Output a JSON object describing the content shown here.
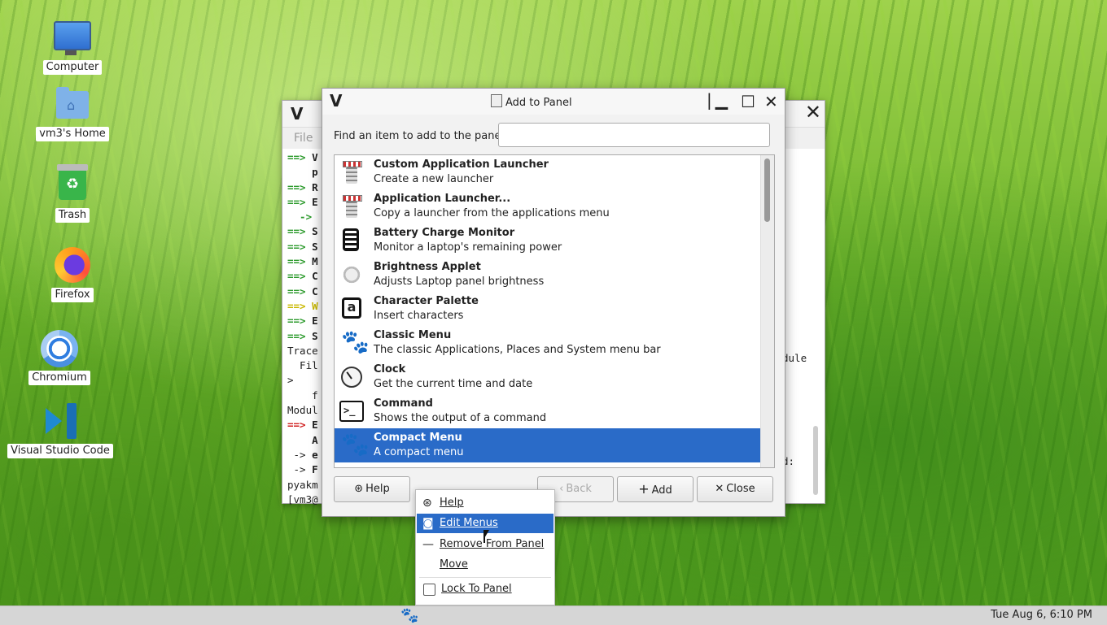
{
  "desktop": {
    "icons": [
      {
        "label": "Computer",
        "icon": "computer-icon"
      },
      {
        "label": "vm3's Home",
        "icon": "home-folder-icon"
      },
      {
        "label": "Trash",
        "icon": "trash-icon"
      },
      {
        "label": "Firefox",
        "icon": "firefox-icon"
      },
      {
        "label": "Chromium",
        "icon": "chromium-icon"
      },
      {
        "label": "Visual Studio Code",
        "icon": "vscode-icon"
      }
    ]
  },
  "terminal": {
    "menu_file": "File",
    "lines": [
      {
        "pre": "==> ",
        "rest": "V",
        "cls": "g"
      },
      {
        "pre": "    ",
        "rest": "p",
        "cls": ""
      },
      {
        "pre": "==> ",
        "rest": "R",
        "cls": "g"
      },
      {
        "pre": "==> ",
        "rest": "E",
        "cls": "g"
      },
      {
        "pre": "  -> ",
        "rest": "",
        "cls": "g"
      },
      {
        "pre": "==> ",
        "rest": "S",
        "cls": "g"
      },
      {
        "pre": "==> ",
        "rest": "S",
        "cls": "g"
      },
      {
        "pre": "==> ",
        "rest": "M",
        "cls": "g"
      },
      {
        "pre": "==> ",
        "rest": "C",
        "cls": "g"
      },
      {
        "pre": "==> ",
        "rest": "C",
        "cls": "g"
      },
      {
        "pre": "==> ",
        "rest": "W",
        "cls": "y"
      },
      {
        "pre": "==> ",
        "rest": "E",
        "cls": "g"
      },
      {
        "pre": "==> ",
        "rest": "S",
        "cls": "g"
      },
      {
        "pre": "Trace",
        "rest": "",
        "cls": "plain"
      },
      {
        "pre": "  Fil",
        "rest": "",
        "cls": "plain"
      },
      {
        "pre": ">",
        "rest": "",
        "cls": "plain"
      },
      {
        "pre": "    f",
        "rest": "",
        "cls": "plain"
      },
      {
        "pre": "Modul",
        "rest": "",
        "cls": "plain"
      },
      {
        "pre": "==> ",
        "rest": "E",
        "cls": "r"
      },
      {
        "pre": "    ",
        "rest": "A",
        "cls": "b"
      },
      {
        "pre": " -> ",
        "rest": "e",
        "cls": "plain"
      },
      {
        "pre": " -> ",
        "rest": "F",
        "cls": "plain"
      },
      {
        "pre": "pyakm",
        "rest": "",
        "cls": "plain"
      },
      {
        "pre": "[vm3@",
        "rest": "",
        "cls": "plain"
      }
    ],
    "right_text_1": "dule",
    "right_text_2": "d:"
  },
  "dialog": {
    "title": "Add to Panel",
    "find_label": "Find an item to add to the panel:",
    "find_value": "",
    "items": [
      {
        "name": "Custom Application Launcher",
        "desc": "Create a new launcher",
        "icon": "launcher-icon",
        "selected": false
      },
      {
        "name": "Application Launcher...",
        "desc": "Copy a launcher from the applications menu",
        "icon": "launcher-icon",
        "selected": false
      },
      {
        "name": "Battery Charge Monitor",
        "desc": "Monitor a laptop's remaining power",
        "icon": "battery-icon",
        "selected": false
      },
      {
        "name": "Brightness Applet",
        "desc": "Adjusts Laptop panel brightness",
        "icon": "brightness-icon",
        "selected": false
      },
      {
        "name": "Character Palette",
        "desc": "Insert characters",
        "icon": "character-palette-icon",
        "selected": false
      },
      {
        "name": "Classic Menu",
        "desc": "The classic Applications, Places and System menu bar",
        "icon": "gnome-foot-icon",
        "selected": false
      },
      {
        "name": "Clock",
        "desc": "Get the current time and date",
        "icon": "clock-icon",
        "selected": false
      },
      {
        "name": "Command",
        "desc": "Shows the output of a command",
        "icon": "terminal-icon",
        "selected": false
      },
      {
        "name": "Compact Menu",
        "desc": "A compact menu",
        "icon": "gnome-foot-icon",
        "selected": true
      }
    ],
    "buttons": {
      "help": "Help",
      "back": "Back",
      "add": "Add",
      "close": "Close"
    }
  },
  "context_menu": {
    "items": [
      "Help",
      "Edit Menus",
      "Remove From Panel",
      "Move"
    ],
    "lock_label": "Lock To Panel",
    "highlighted": "Edit Menus"
  },
  "panel": {
    "clock": "Tue Aug  6,  6:10 PM"
  },
  "colors": {
    "selection": "#2a6bc8"
  }
}
